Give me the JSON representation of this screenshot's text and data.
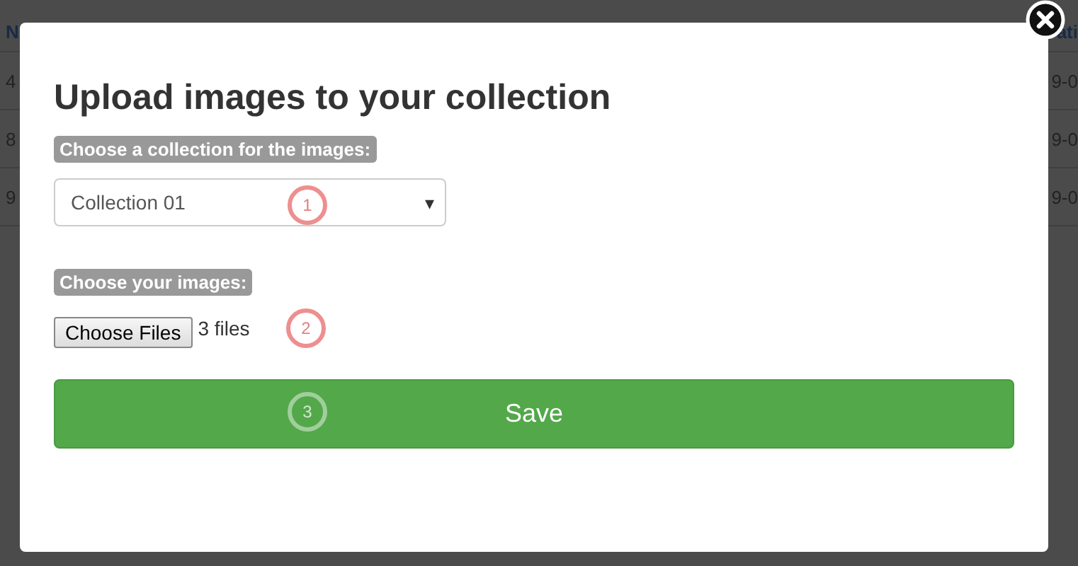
{
  "background_table": {
    "header": {
      "column_1": "N",
      "column_2": "ati"
    },
    "rows": [
      {
        "column_1": "4",
        "column_2": "9-0"
      },
      {
        "column_1": "8",
        "column_2": "9-0"
      },
      {
        "column_1": "9",
        "column_2": "9-0"
      }
    ]
  },
  "dialog": {
    "title": "Upload images to your collection",
    "collection_label": "Choose a collection for the images:",
    "collection_select": {
      "value": "Collection 01",
      "caret": "▾"
    },
    "images_label": "Choose your images:",
    "file_button": "Choose Files",
    "file_status": "3 files",
    "save_button": "Save",
    "step_markers": [
      "1",
      "2",
      "3"
    ]
  }
}
